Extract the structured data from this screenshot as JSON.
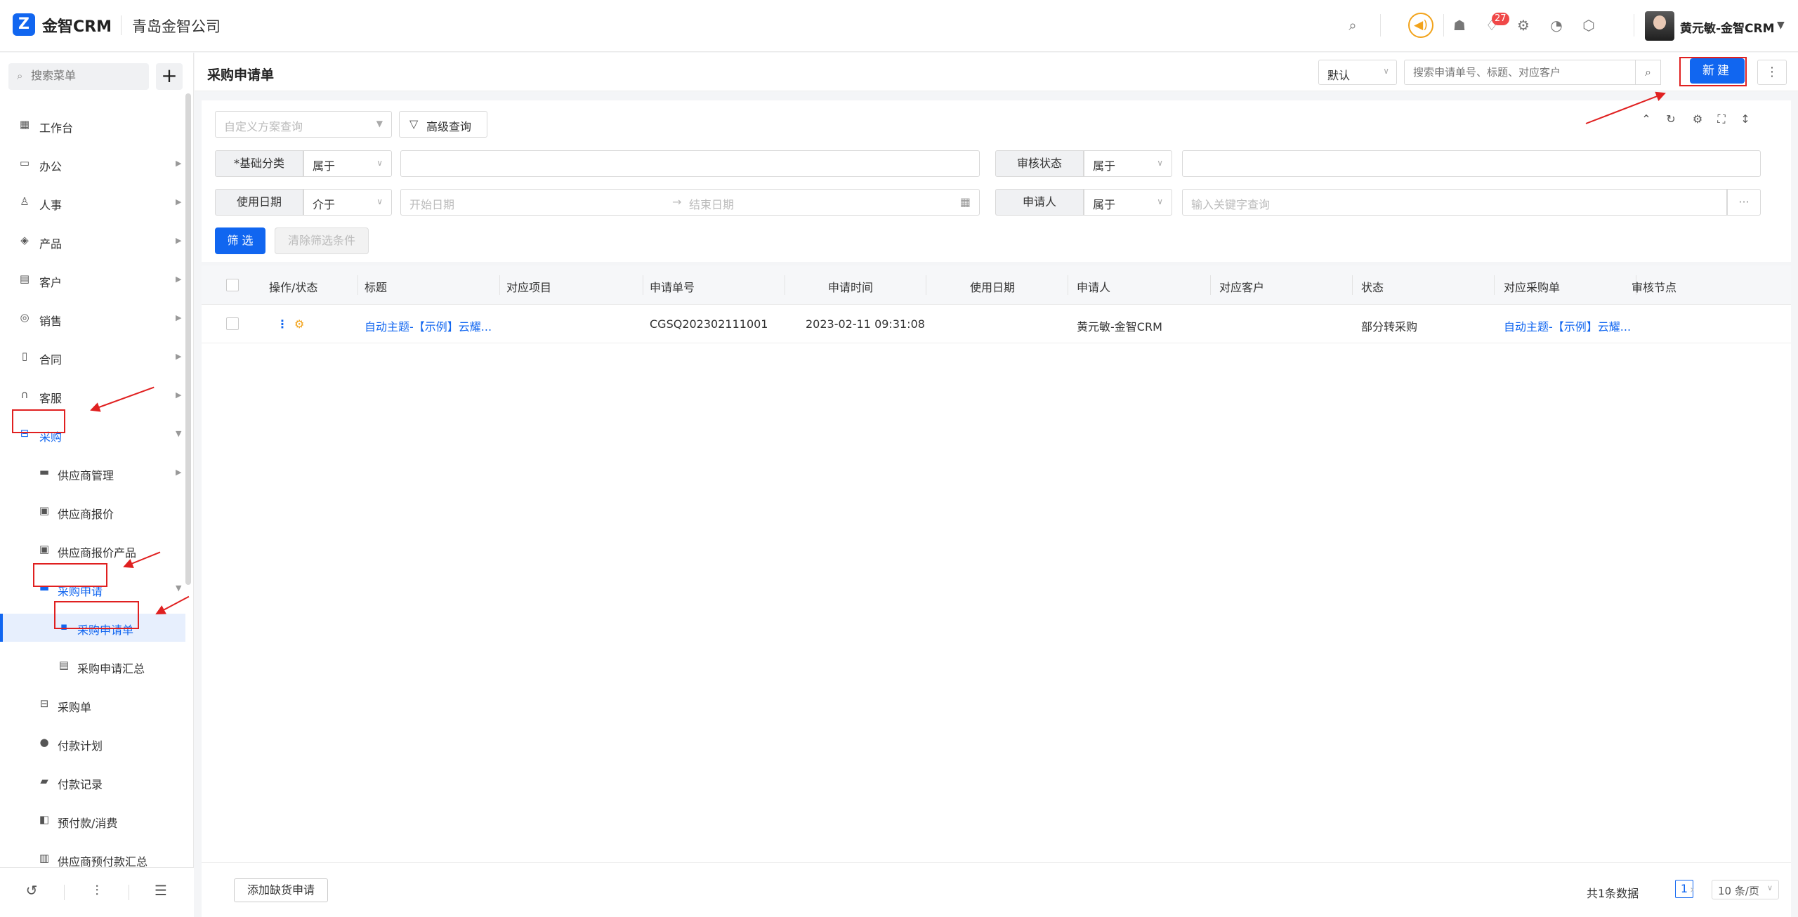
{
  "app": {
    "brand": "金智CRM",
    "company": "青岛金智公司",
    "logo_letter": "Z",
    "notification_count": "27",
    "user_name": "黄元敏-金智CRM"
  },
  "sidebar": {
    "search_placeholder": "搜索菜单",
    "add_label": "+",
    "items": [
      {
        "label": "工作台",
        "icon": "dashboard-icon"
      },
      {
        "label": "办公",
        "icon": "office-icon"
      },
      {
        "label": "人事",
        "icon": "people-icon"
      },
      {
        "label": "产品",
        "icon": "box-icon"
      },
      {
        "label": "客户",
        "icon": "customer-icon"
      },
      {
        "label": "销售",
        "icon": "sales-icon"
      },
      {
        "label": "合同",
        "icon": "contract-icon"
      },
      {
        "label": "客服",
        "icon": "headset-icon"
      },
      {
        "label": "采购",
        "icon": "cart-icon"
      },
      {
        "label": "供应商管理",
        "icon": "folder-icon"
      },
      {
        "label": "供应商报价",
        "icon": "quote-icon"
      },
      {
        "label": "供应商报价产品",
        "icon": "quote-product-icon"
      },
      {
        "label": "采购申请",
        "icon": "folder-open-icon"
      },
      {
        "label": "采购申请单",
        "icon": "form-icon"
      },
      {
        "label": "采购申请汇总",
        "icon": "summary-icon"
      },
      {
        "label": "采购单",
        "icon": "cart-icon"
      },
      {
        "label": "付款计划",
        "icon": "plan-icon"
      },
      {
        "label": "付款记录",
        "icon": "record-icon"
      },
      {
        "label": "预付款/消费",
        "icon": "prepay-icon"
      },
      {
        "label": "供应商预付款汇总",
        "icon": "ledger-icon"
      }
    ]
  },
  "header": {
    "title": "采购申请单",
    "view_select": "默认",
    "search_placeholder": "搜索申请单号、标题、对应客户",
    "new_button": "新建"
  },
  "filters": {
    "scheme_placeholder": "自定义方案查询",
    "advanced_button": "高级查询",
    "rows": [
      {
        "label": "*基础分类",
        "operator": "属于",
        "value": ""
      },
      {
        "label": "审核状态",
        "operator": "属于",
        "value": ""
      },
      {
        "label": "使用日期",
        "operator": "介于",
        "start_placeholder": "开始日期",
        "end_placeholder": "结束日期"
      },
      {
        "label": "申请人",
        "operator": "属于",
        "placeholder": "输入关键字查询"
      }
    ],
    "apply_button": "筛 选",
    "clear_button": "清除筛选条件",
    "ellipsis": "···"
  },
  "table": {
    "columns": [
      "操作/状态",
      "标题",
      "对应项目",
      "申请单号",
      "申请时间",
      "使用日期",
      "申请人",
      "对应客户",
      "状态",
      "对应采购单",
      "审核节点"
    ],
    "rows": [
      {
        "title": "自动主题-【示例】云耀...",
        "project": "",
        "number": "CGSQ202302111001",
        "time": "2023-02-11 09:31:08",
        "use_date": "",
        "applicant": "黄元敏-金智CRM",
        "customer": "",
        "status": "部分转采购",
        "purchase_order": "自动主题-【示例】云耀...",
        "audit_node": ""
      }
    ]
  },
  "footer": {
    "add_shortage_button": "添加缺货申请",
    "total_text": "共1条数据",
    "current_page": "1",
    "page_size": "10 条/页"
  },
  "colors": {
    "accent": "#1166f0",
    "annotation": "#e02020",
    "warning": "#f2a31b"
  }
}
